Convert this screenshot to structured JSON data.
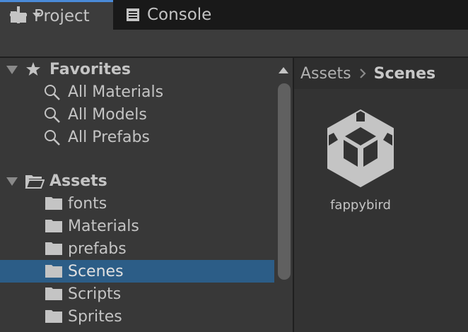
{
  "tabs": {
    "project": "Project",
    "console": "Console"
  },
  "colors": {
    "accent": "#4a8ad8",
    "selection": "#2c5d87",
    "panel": "#383838"
  },
  "tree": {
    "favorites": {
      "label": "Favorites",
      "items": [
        "All Materials",
        "All Models",
        "All Prefabs"
      ]
    },
    "assets": {
      "label": "Assets",
      "folders": [
        "fonts",
        "Materials",
        "prefabs",
        "Scenes",
        "Scripts",
        "Sprites"
      ],
      "selected": "Scenes"
    }
  },
  "breadcrumb": {
    "root": "Assets",
    "current": "Scenes"
  },
  "assets": [
    {
      "name": "fappybird",
      "icon": "unity-scene-icon"
    }
  ]
}
